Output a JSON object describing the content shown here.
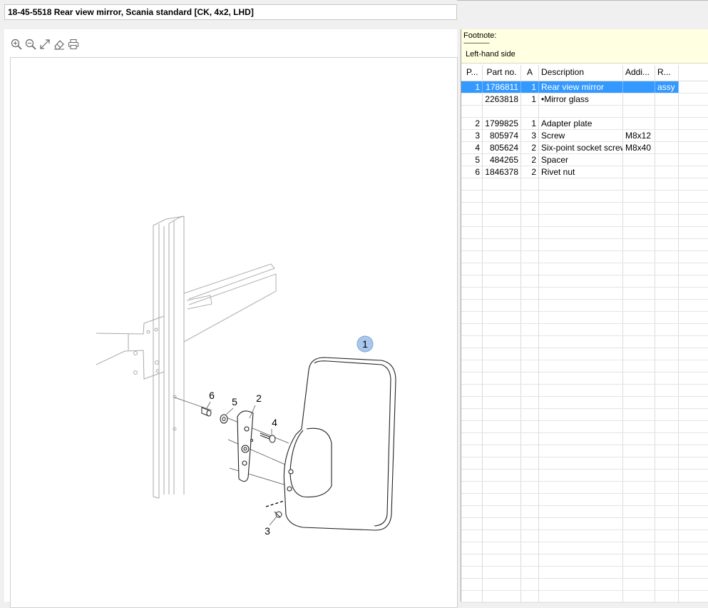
{
  "window": {
    "title": "18-45-5518 Rear view mirror, Scania standard [CK, 4x2, LHD]"
  },
  "toolbar": {
    "tools": [
      {
        "icon": "zoom-in-icon"
      },
      {
        "icon": "zoom-out-icon"
      },
      {
        "icon": "fit-to-window-icon"
      },
      {
        "icon": "eraser-icon"
      },
      {
        "icon": "print-icon"
      }
    ]
  },
  "drawing": {
    "callouts": [
      "1",
      "2",
      "3",
      "4",
      "5",
      "6"
    ],
    "highlight_color": "#a9c6ec"
  },
  "footnote": {
    "label": "Footnote:",
    "separator": "------------------",
    "text": "Left-hand side"
  },
  "table": {
    "columns": [
      "P...",
      "Part no.",
      "A",
      "Description",
      "Addi...",
      "R..."
    ],
    "rows": [
      {
        "pos": "1",
        "part_no": "1786811",
        "qty": "1",
        "description": "Rear view mirror",
        "additional": "",
        "remark": "assy",
        "selected": true
      },
      {
        "pos": "",
        "part_no": "2263818",
        "qty": "1",
        "description": "•Mirror glass",
        "additional": "",
        "remark": "",
        "selected": false
      },
      {
        "pos": "",
        "part_no": "",
        "qty": "",
        "description": "",
        "additional": "",
        "remark": "",
        "selected": false
      },
      {
        "pos": "2",
        "part_no": "1799825",
        "qty": "1",
        "description": "Adapter plate",
        "additional": "",
        "remark": "",
        "selected": false
      },
      {
        "pos": "3",
        "part_no": "805974",
        "qty": "3",
        "description": "Screw",
        "additional": "M8x12",
        "remark": "",
        "selected": false
      },
      {
        "pos": "4",
        "part_no": "805624",
        "qty": "2",
        "description": "Six-point socket screw",
        "additional": "M8x40",
        "remark": "",
        "selected": false
      },
      {
        "pos": "5",
        "part_no": "484265",
        "qty": "2",
        "description": "Spacer",
        "additional": "",
        "remark": "",
        "selected": false
      },
      {
        "pos": "6",
        "part_no": "1846378",
        "qty": "2",
        "description": "Rivet nut",
        "additional": "",
        "remark": "",
        "selected": false
      }
    ],
    "selection_color": "#3399ff"
  }
}
